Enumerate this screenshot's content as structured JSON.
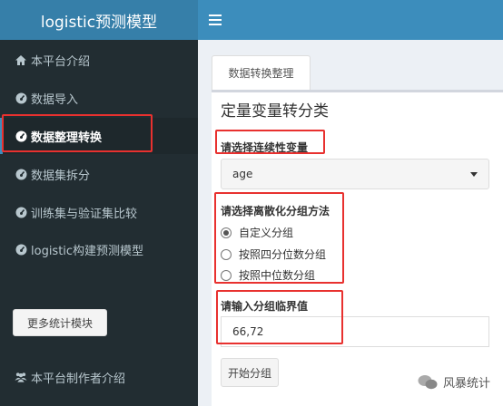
{
  "app": {
    "title": "logistic预测模型"
  },
  "sidebar": {
    "items": [
      {
        "label": "本平台介绍",
        "icon": "home-icon"
      },
      {
        "label": "数据导入",
        "icon": "dashboard-icon"
      },
      {
        "label": "数据整理转换",
        "icon": "dashboard-icon",
        "active": true
      },
      {
        "label": "数据集拆分",
        "icon": "dashboard-icon"
      },
      {
        "label": "训练集与验证集比较",
        "icon": "dashboard-icon"
      },
      {
        "label": "logistic构建预测模型",
        "icon": "dashboard-icon"
      }
    ],
    "more_button": "更多统计模块",
    "author_link": "本平台制作者介绍"
  },
  "main": {
    "tab_label": "数据转换整理",
    "panel_title": "定量变量转分类",
    "select_label": "请选择连续性变量",
    "select_value": "age",
    "method_label": "请选择离散化分组方法",
    "methods": [
      "自定义分组",
      "按照四分位数分组",
      "按照中位数分组"
    ],
    "method_selected": "自定义分组",
    "threshold_label": "请输入分组临界值",
    "threshold_value": "66,72",
    "start_button": "开始分组"
  },
  "watermark": {
    "text": "风暴统计"
  },
  "colors": {
    "header": "#3c8dbc",
    "brand": "#367fa9",
    "sidebar": "#222d32",
    "highlight": "#e8312f"
  }
}
